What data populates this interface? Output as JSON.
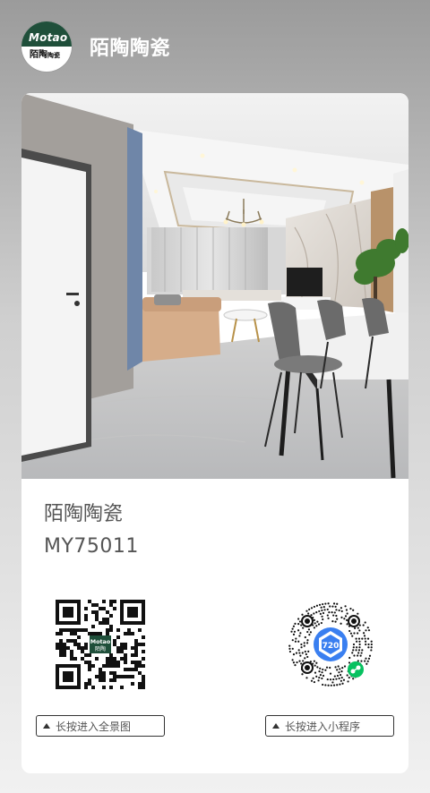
{
  "header": {
    "logo": {
      "brand": "Motao",
      "cn_text": "陌陶",
      "cn_small": "陶瓷"
    },
    "title": "陌陶陶瓷"
  },
  "product": {
    "name": "陌陶陶瓷",
    "code": "MY75011"
  },
  "actions": {
    "panorama_label": "长按进入全景图",
    "miniprogram_label": "长按进入小程序"
  },
  "qr_left_logo": {
    "brand": "Motao",
    "cn": "陌陶"
  },
  "qr_right_badge": "720",
  "colors": {
    "brand_green": "#1f4f3a",
    "mini_green": "#07c160",
    "qr_blue": "#3a7ff0"
  }
}
